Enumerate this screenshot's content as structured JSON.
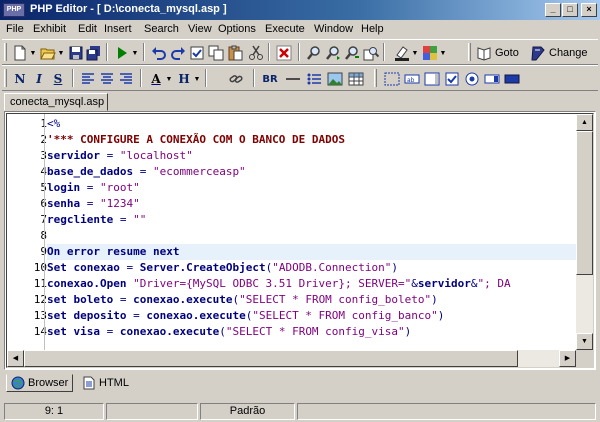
{
  "window": {
    "title": "PHP Editor - [ D:\\conecta_mysql.asp ]",
    "icon_label": "PHP",
    "controls": {
      "minimize": "_",
      "maximize": "□",
      "close": "×"
    }
  },
  "menu": [
    {
      "label": "File"
    },
    {
      "label": "Exhibit"
    },
    {
      "label": "Edit"
    },
    {
      "label": "Insert"
    },
    {
      "label": "Search"
    },
    {
      "label": "View"
    },
    {
      "label": "Options"
    },
    {
      "label": "Execute"
    },
    {
      "label": "Window"
    },
    {
      "label": "Help"
    }
  ],
  "toolbar1": {
    "goto_label": "Goto",
    "change_label": "Change"
  },
  "toolbar2": {
    "bold": "N",
    "italic": "I",
    "strike": "S",
    "font_color": "A",
    "heading": "H",
    "break": "BR"
  },
  "document_tab": {
    "label": "conecta_mysql.asp"
  },
  "editor": {
    "current_line": 9,
    "lines": [
      {
        "n": "1",
        "text": "<%"
      },
      {
        "n": "2",
        "text": "'*** CONFIGURE A CONEXÃO COM O BANCO DE DADOS"
      },
      {
        "n": "3",
        "text": "servidor = \"localhost\""
      },
      {
        "n": "4",
        "text": "base_de_dados = \"ecommerceasp\""
      },
      {
        "n": "5",
        "text": "login = \"root\""
      },
      {
        "n": "6",
        "text": "senha = \"1234\""
      },
      {
        "n": "7",
        "text": "regcliente = \"\""
      },
      {
        "n": "8",
        "text": ""
      },
      {
        "n": "9",
        "text": "On error resume next"
      },
      {
        "n": "10",
        "text": "Set conexao = Server.CreateObject(\"ADODB.Connection\")"
      },
      {
        "n": "11",
        "text": "conexao.Open \"Driver={MySQL ODBC 3.51 Driver}; SERVER=\"&servidor&\"; DA"
      },
      {
        "n": "12",
        "text": "set boleto = conexao.execute(\"SELECT * FROM config_boleto\")"
      },
      {
        "n": "13",
        "text": "set deposito = conexao.execute(\"SELECT * FROM config_banco\")"
      },
      {
        "n": "14",
        "text": "set visa = conexao.execute(\"SELECT * FROM config_visa\")"
      }
    ]
  },
  "bottom_tabs": [
    {
      "label": "Browser"
    },
    {
      "label": "HTML"
    }
  ],
  "status": {
    "position": "9: 1",
    "modified": "",
    "mode": "Padrão"
  },
  "colors": {
    "title_gradient_start": "#0a246a",
    "keyword": "#00007f",
    "comment": "#7f0000",
    "string": "#7f007f",
    "current_line": "#e7f1fb"
  }
}
